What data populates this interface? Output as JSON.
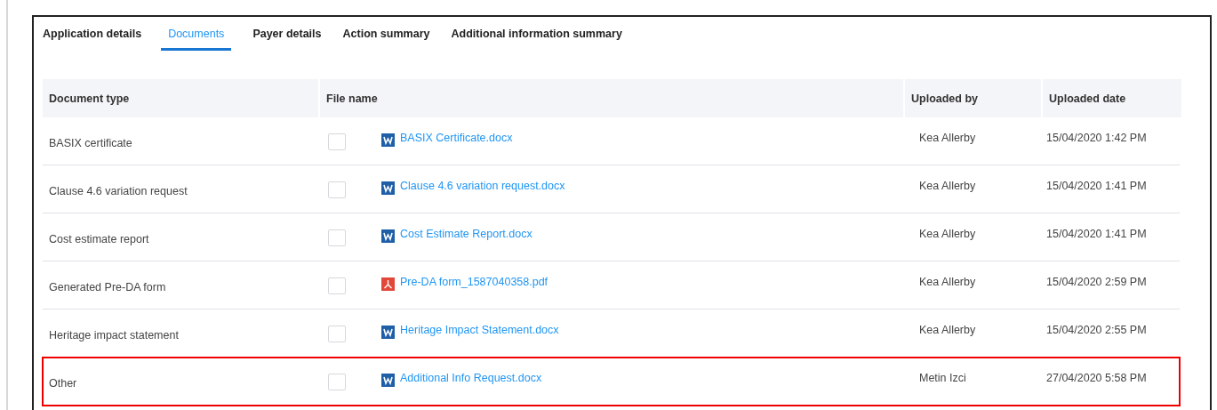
{
  "tabs": [
    {
      "label": "Application details",
      "selected": false
    },
    {
      "label": "Documents",
      "selected": true
    },
    {
      "label": "Payer details",
      "selected": false
    },
    {
      "label": "Action summary",
      "selected": false
    },
    {
      "label": "Additional information summary",
      "selected": false
    }
  ],
  "table": {
    "columns": [
      "Document type",
      "File name",
      "Uploaded by",
      "Uploaded date"
    ],
    "rows": [
      {
        "document_type": "BASIX certificate",
        "checked": false,
        "kind": "word",
        "file_name": "BASIX Certificate.docx",
        "uploaded_by": "Kea Allerby",
        "uploaded_date": "15/04/2020 1:42 PM",
        "highlighted": false
      },
      {
        "document_type": "Clause 4.6 variation request",
        "checked": false,
        "kind": "word",
        "file_name": "Clause 4.6 variation request.docx",
        "uploaded_by": "Kea Allerby",
        "uploaded_date": "15/04/2020 1:41 PM",
        "highlighted": false
      },
      {
        "document_type": "Cost estimate report",
        "checked": false,
        "kind": "word",
        "file_name": "Cost Estimate Report.docx",
        "uploaded_by": "Kea Allerby",
        "uploaded_date": "15/04/2020 1:41 PM",
        "highlighted": false
      },
      {
        "document_type": "Generated Pre-DA form",
        "checked": false,
        "kind": "pdf",
        "file_name": "Pre-DA form_1587040358.pdf",
        "uploaded_by": "Kea Allerby",
        "uploaded_date": "15/04/2020 2:59 PM",
        "highlighted": false
      },
      {
        "document_type": "Heritage impact statement",
        "checked": false,
        "kind": "word",
        "file_name": "Heritage Impact Statement.docx",
        "uploaded_by": "Kea Allerby",
        "uploaded_date": "15/04/2020 2:55 PM",
        "highlighted": false
      },
      {
        "document_type": "Other",
        "checked": false,
        "kind": "word",
        "file_name": "Additional Info Request.docx",
        "uploaded_by": "Metin Izci",
        "uploaded_date": "27/04/2020 5:58 PM",
        "highlighted": true
      }
    ]
  }
}
